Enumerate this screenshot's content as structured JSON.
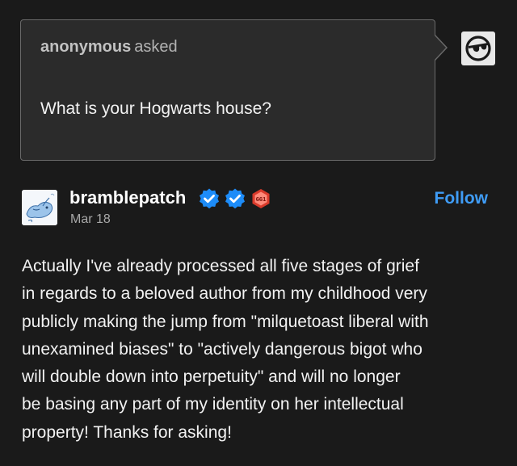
{
  "ask": {
    "asker": "anonymous",
    "verb": "asked",
    "question": "What is your Hogwarts house?"
  },
  "post": {
    "username": "bramblepatch",
    "date": "Mar 18",
    "follow_label": "Follow",
    "badge_text": "661",
    "body_lines": [
      "Actually I've already processed all five stages of grief",
      "in regards to a beloved author from my childhood very",
      "publicly making the jump from \"milquetoast liberal with",
      "unexamined biases\" to \"actively dangerous bigot who",
      "will double down into perpetuity\" and will no longer",
      "be basing any part of my identity on her intellectual",
      "property! Thanks for asking!"
    ]
  },
  "icons": {
    "anon_avatar": "sunglasses-face-icon",
    "verified_badge_1": "verified-check-icon",
    "verified_badge_2": "verified-check-icon",
    "red_badge": "hexagon-badge-icon"
  },
  "colors": {
    "background": "#1a1a1a",
    "ask_box": "#2b2b2b",
    "ask_border": "#6a6a6a",
    "follow": "#3f9cf5",
    "verified": "#1d8cf8",
    "red_badge": "#d93a2b"
  }
}
